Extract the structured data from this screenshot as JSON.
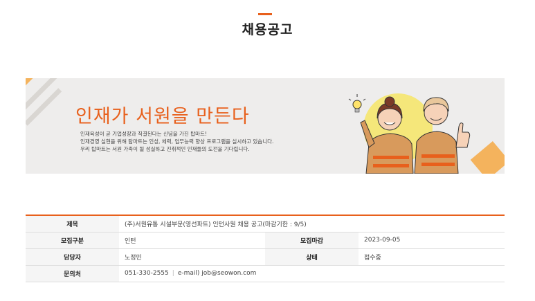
{
  "page": {
    "title": "채용공고"
  },
  "banner": {
    "headline": "인재가 서원을 만든다",
    "lines": [
      "인재육성이 곧 기업성장과 직결된다는 신념을 가진 탑마트!",
      "인재경영 실현을 위해 탑마트는 인성, 체력, 업무능력 향상 프로그램을 실시하고 있습니다.",
      "우리 탑마트는 서원 가족이 될 성실하고 진취적인 인재들의 도전을 기다립니다."
    ],
    "accent_color": "#e8601c",
    "illustration_icons": [
      "lightbulb-icon",
      "thumbs-up-icon"
    ]
  },
  "info": {
    "title_label": "제목",
    "title_value": "(주)서원유통 시설부문(영선파트) 인턴사원 채용 공고(마감기한 : 9/5)",
    "category_label": "모집구분",
    "category_value": "인턴",
    "deadline_label": "모집마감",
    "deadline_value": "2023-09-05",
    "manager_label": "담당자",
    "manager_value": "노정민",
    "status_label": "상태",
    "status_value": "접수중",
    "contact_label": "문의처",
    "contact_phone": "051-330-2555",
    "contact_email": "e-mail) job@seowon.com"
  }
}
